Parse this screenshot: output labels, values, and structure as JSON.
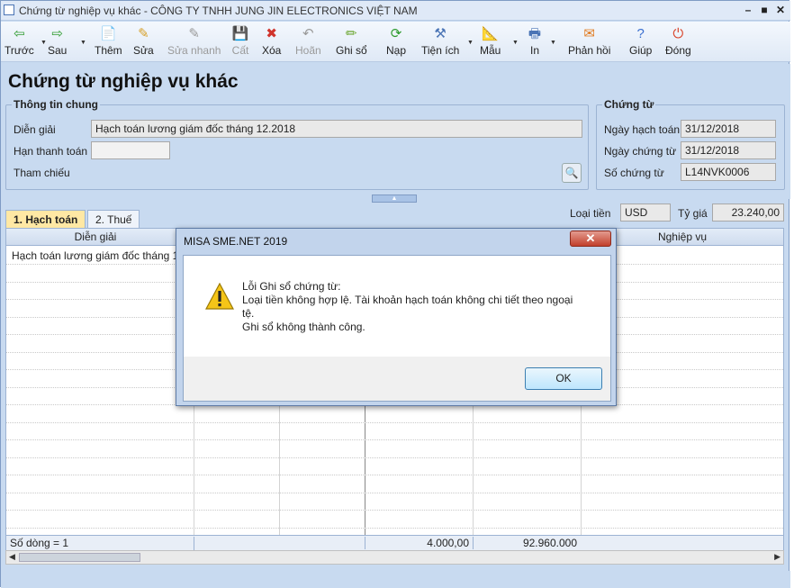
{
  "window": {
    "title": "Chứng từ nghiệp vụ khác - CÔNG TY TNHH JUNG JIN ELECTRONICS VIỆT NAM",
    "minimize": "–",
    "maximize": "■",
    "close": "✕"
  },
  "toolbar": {
    "buttons": [
      {
        "label": "Trước",
        "icon": "arrow-left-icon",
        "glyph": "⇦",
        "color": "#2e9b2e",
        "enabled": true
      },
      {
        "label": "Sau",
        "icon": "arrow-right-icon",
        "glyph": "⇨",
        "color": "#2e9b2e",
        "enabled": true
      },
      {
        "label": "Thêm",
        "icon": "add-document-icon",
        "glyph": "📄",
        "color": "#d6a12b",
        "enabled": true
      },
      {
        "label": "Sửa",
        "icon": "edit-icon",
        "glyph": "✎",
        "color": "#d6a12b",
        "enabled": true
      },
      {
        "label": "Sửa nhanh",
        "icon": "quick-edit-icon",
        "glyph": "✎",
        "color": "#9a9a9a",
        "enabled": false
      },
      {
        "label": "Cất",
        "icon": "save-icon",
        "glyph": "💾",
        "color": "#9a9a9a",
        "enabled": false
      },
      {
        "label": "Xóa",
        "icon": "delete-icon",
        "glyph": "✖",
        "color": "#d0342c",
        "enabled": true
      },
      {
        "label": "Hoãn",
        "icon": "undo-icon",
        "glyph": "↶",
        "color": "#9a9a9a",
        "enabled": false
      },
      {
        "label": "Ghi sổ",
        "icon": "post-pen-icon",
        "glyph": "✏",
        "color": "#6aa52e",
        "enabled": true
      },
      {
        "label": "Nạp",
        "icon": "reload-icon",
        "glyph": "⟳",
        "color": "#2e9b2e",
        "enabled": true
      },
      {
        "label": "Tiện ích",
        "icon": "tools-icon",
        "glyph": "⚒",
        "color": "#4a74b5",
        "enabled": true
      },
      {
        "label": "Mẫu",
        "icon": "template-icon",
        "glyph": "📐",
        "color": "#d6a12b",
        "enabled": true
      },
      {
        "label": "In",
        "icon": "print-icon",
        "glyph": "🖶",
        "color": "#4a74b5",
        "enabled": true
      },
      {
        "label": "Phản hồi",
        "icon": "feedback-mail-icon",
        "glyph": "✉",
        "color": "#e07a1f",
        "enabled": true
      },
      {
        "label": "Giúp",
        "icon": "help-icon",
        "glyph": "?",
        "color": "#3a6fd0",
        "enabled": true
      },
      {
        "label": "Đóng",
        "icon": "power-close-icon",
        "glyph": "⏻",
        "color": "#d9452b",
        "enabled": true
      }
    ]
  },
  "page": {
    "title": "Chứng từ nghiệp vụ khác"
  },
  "general": {
    "group_title": "Thông tin chung",
    "description_label": "Diễn giải",
    "description_value": "Hạch toán lương giám đốc tháng 12.2018",
    "due_label": "Hạn thanh toán",
    "due_value": "",
    "reference_label": "Tham chiếu"
  },
  "voucher": {
    "group_title": "Chứng từ",
    "posting_date_label": "Ngày hạch toán",
    "posting_date_value": "31/12/2018",
    "voucher_date_label": "Ngày chứng từ",
    "voucher_date_value": "31/12/2018",
    "voucher_no_label": "Số chứng từ",
    "voucher_no_value": "L14NVK0006"
  },
  "currency": {
    "label": "Loại tiền",
    "value": "USD",
    "rate_label": "Tỷ giá",
    "rate_value": "23.240,00"
  },
  "tabs": [
    {
      "label": "1. Hạch toán",
      "active": true
    },
    {
      "label": "2. Thuế",
      "active": false
    }
  ],
  "grid": {
    "columns": [
      "Diễn giải",
      "Nghiệp vụ"
    ],
    "rows": [
      {
        "description": "Hạch toán lương giám đốc tháng 12.20"
      }
    ],
    "footer": {
      "row_count": "Số dòng = 1",
      "total_amount": "4.000,00",
      "total_converted": "92.960.000"
    }
  },
  "dialog": {
    "title": "MISA SME.NET 2019",
    "close": "✕",
    "message_lines": [
      "Lỗi Ghi sổ chứng từ:",
      "Loại tiền không hợp lệ. Tài khoản hạch toán không chi tiết theo ngoại tệ.",
      "Ghi sổ không thành công."
    ],
    "ok_label": "OK",
    "icon": "warning-icon"
  }
}
